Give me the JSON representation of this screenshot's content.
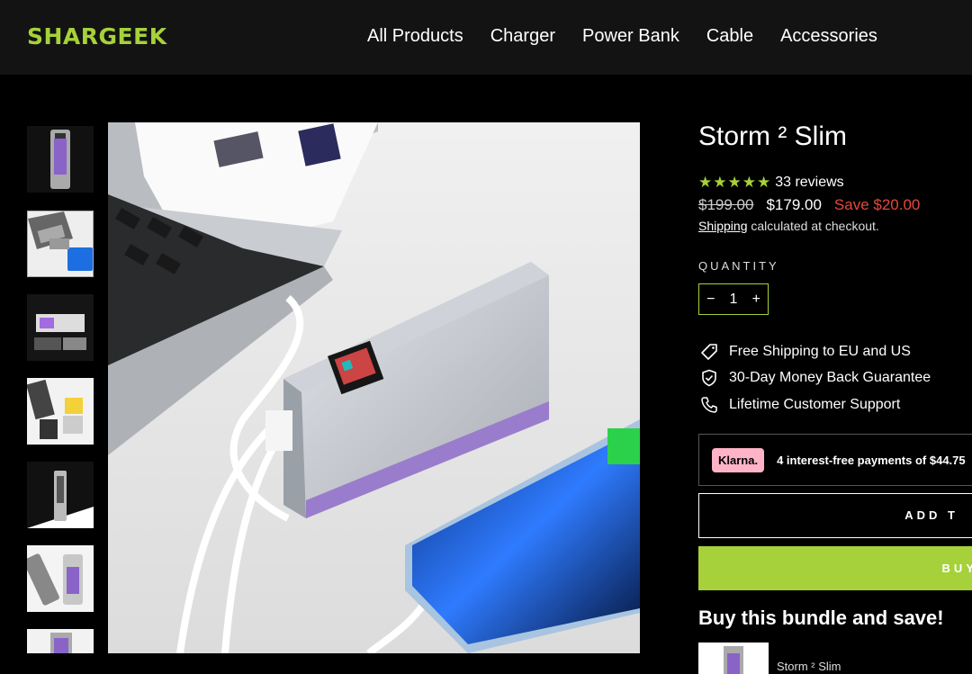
{
  "header": {
    "logo": "SHARGEEK",
    "nav": [
      "All Products",
      "Charger",
      "Power Bank",
      "Cable",
      "Accessories"
    ]
  },
  "product": {
    "title": "Storm ² Slim",
    "stars": "★★★★★",
    "reviews": "33 reviews",
    "old_price": "$199.00",
    "price": "$179.00",
    "save": "Save $20.00",
    "shipping_link": "Shipping",
    "shipping_rest": " calculated at checkout.",
    "quantity_label": "QUANTITY",
    "quantity_minus": "−",
    "quantity_value": "1",
    "quantity_plus": "+",
    "perks": [
      {
        "icon": "tag-icon",
        "label": "Free Shipping to EU and US"
      },
      {
        "icon": "shield-check-icon",
        "label": "30-Day Money Back Guarantee"
      },
      {
        "icon": "phone-icon",
        "label": "Lifetime Customer Support"
      }
    ],
    "klarna_badge": "Klarna.",
    "klarna_text": "4 interest-free payments of $44.75",
    "add_button": "ADD T",
    "buy_button": "BUY",
    "bundle_title": "Buy this bundle and save!",
    "bundle_item": "Storm ² Slim"
  },
  "colors": {
    "accent": "#a6d13a",
    "sale": "#e5483b",
    "header_bg": "#131313"
  }
}
